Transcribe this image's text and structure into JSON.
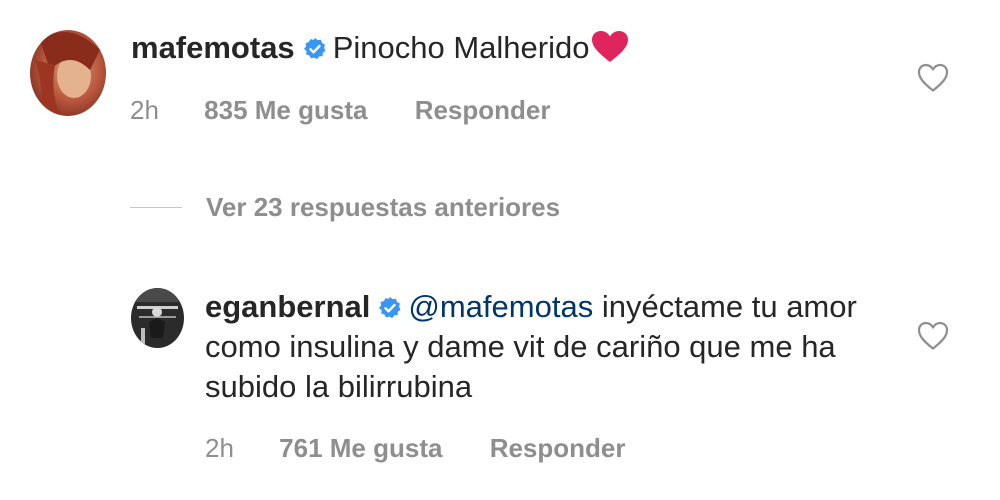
{
  "comment": {
    "username": "mafemotas",
    "verified_icon": "verified-badge-icon",
    "text": "Pinocho Malherido",
    "emoji": "heart-emoji",
    "time": "2h",
    "likes": "835 Me gusta",
    "reply_label": "Responder",
    "like_icon": "heart-outline-icon"
  },
  "view_replies": {
    "label": "Ver 23 respuestas anteriores"
  },
  "reply": {
    "username": "eganbernal",
    "verified_icon": "verified-badge-icon",
    "mention": "@mafemotas",
    "text": "inyéctame tu amor como insulina y dame vit de cariño que me ha subido la bilirrubina",
    "time": "2h",
    "likes": "761 Me gusta",
    "reply_label": "Responder",
    "like_icon": "heart-outline-icon"
  },
  "colors": {
    "text": "#262626",
    "secondary": "#8e8e8e",
    "mention": "#00376b",
    "verified": "#3897f0",
    "heart": "#e0245e"
  }
}
